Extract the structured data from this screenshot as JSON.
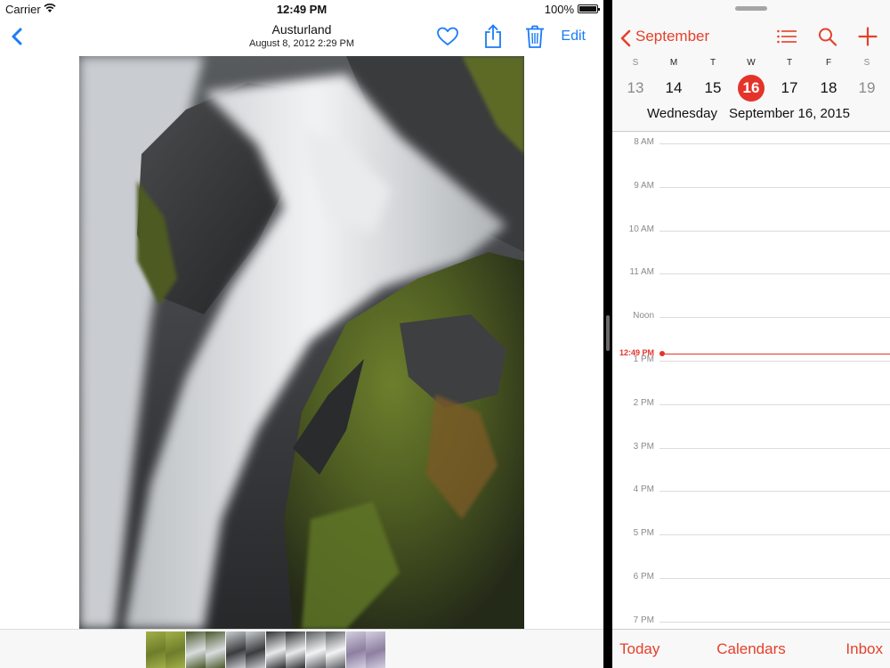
{
  "status_bar": {
    "carrier": "Carrier",
    "time": "12:49 PM",
    "battery": "100%"
  },
  "photos": {
    "title": "Austurland",
    "subtitle": "August 8, 2012  2:29 PM",
    "edit_label": "Edit",
    "accent_color": "#1b7bf5",
    "icons": [
      "back-chevron-icon",
      "heart-icon",
      "share-icon",
      "trash-icon"
    ],
    "thumbnails": [
      "moss-rock",
      "moss-rock",
      "waterfall-cliff",
      "waterfall-cliff",
      "rock-arch",
      "rock-arch",
      "waterfall-current",
      "waterfall-current",
      "white-fall",
      "white-fall",
      "misty-rocks",
      "misty-rocks"
    ]
  },
  "calendar": {
    "month_label": "September",
    "accent_color": "#e5332a",
    "weekdays": [
      "S",
      "M",
      "T",
      "W",
      "T",
      "F",
      "S"
    ],
    "dates": [
      "13",
      "14",
      "15",
      "16",
      "17",
      "18",
      "19"
    ],
    "selected_index": 3,
    "day_name": "Wednesday",
    "full_date": "September 16, 2015",
    "hours": [
      "8 AM",
      "9 AM",
      "10 AM",
      "11 AM",
      "Noon",
      "1 PM",
      "2 PM",
      "3 PM",
      "4 PM",
      "5 PM",
      "6 PM",
      "7 PM"
    ],
    "now_label": "12:49 PM",
    "toolbar": {
      "today": "Today",
      "calendars": "Calendars",
      "inbox": "Inbox"
    }
  }
}
